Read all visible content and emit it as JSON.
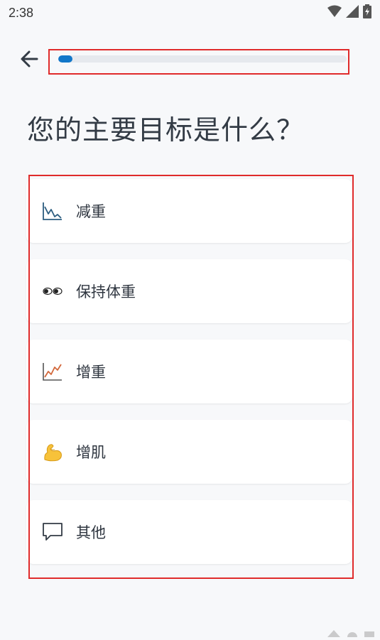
{
  "status_bar": {
    "time": "2:38"
  },
  "progress": {
    "value_percent": 5,
    "fill_color": "#1277c9"
  },
  "title": "您的主要目标是什么？",
  "options": [
    {
      "label": "减重",
      "icon": "trend-down-chart-icon"
    },
    {
      "label": "保持体重",
      "icon": "eyes-icon"
    },
    {
      "label": "增重",
      "icon": "trend-up-chart-icon"
    },
    {
      "label": "增肌",
      "icon": "flexed-biceps-icon"
    },
    {
      "label": "其他",
      "icon": "speech-bubble-icon"
    }
  ],
  "accent_color": "#1277c9",
  "highlight_color": "#e02b2b"
}
